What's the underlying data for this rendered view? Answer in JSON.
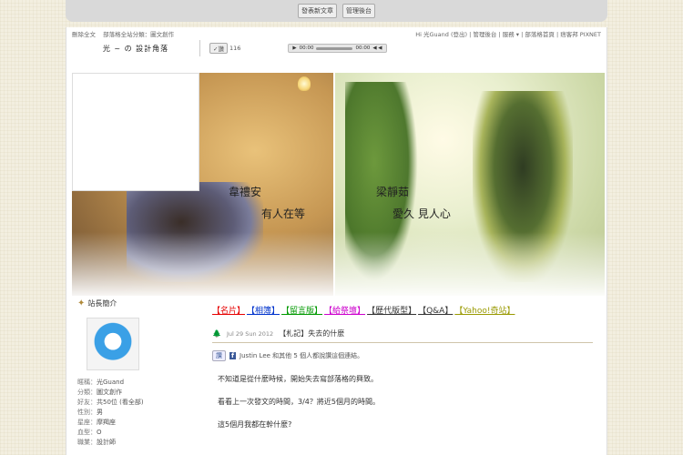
{
  "adminbar": {
    "new_post": "發表新文章",
    "admin": "管理後台"
  },
  "topnav": {
    "left": [
      "刪除全文",
      "部落格全站分類：圖文創作"
    ],
    "right": [
      "Hi 光Guand (登出)",
      "管理後台",
      "服務 ▾",
      "部落格首頁",
      "痞客邦 PIXNET"
    ]
  },
  "header": {
    "blog_title": "光 ~ の 設計角落",
    "like_count": "116",
    "player_time_start": "00:00",
    "player_time_end": "00:00"
  },
  "banner": {
    "left_name": "韋禮安",
    "left_song": "有人在等",
    "right_name": "梁靜茹",
    "right_song": "愛久 見人心"
  },
  "sidebar": {
    "title": "站長簡介",
    "info": [
      {
        "k": "暱稱：",
        "v": "光Guand"
      },
      {
        "k": "分類：",
        "v": "圖文創作"
      },
      {
        "k": "好友：",
        "v": "共50位 (看全部)"
      },
      {
        "k": "性別：",
        "v": "男"
      },
      {
        "k": "星座：",
        "v": "摩羯座"
      },
      {
        "k": "血型：",
        "v": "O"
      },
      {
        "k": "職業：",
        "v": "設計師"
      }
    ]
  },
  "main": {
    "links": [
      {
        "label": "【名片】",
        "color": "#e60000"
      },
      {
        "label": "【相簿】",
        "color": "#0033cc"
      },
      {
        "label": "【留言版】",
        "color": "#009900"
      },
      {
        "label": "【給祭壇】",
        "color": "#cc00cc"
      },
      {
        "label": "【歷代版型】",
        "color": "#333333"
      },
      {
        "label": "【Q&A】",
        "color": "#333333"
      },
      {
        "label": "【Yahoo!奇站】",
        "color": "#999900"
      }
    ],
    "post_date": "Jul 29 Sun 2012",
    "post_title": "【札記】失去的什麼",
    "fb_like": "讚",
    "fb_text": "Justin Lee 和其他 5 個人都說讚這個連結。",
    "paragraphs": [
      "不知道是從什麼時候，開始失去寫部落格的興致。",
      "看看上一次發文的時間，3/4？將近5個月的時間。",
      "這5個月我都在幹什麼?"
    ]
  }
}
